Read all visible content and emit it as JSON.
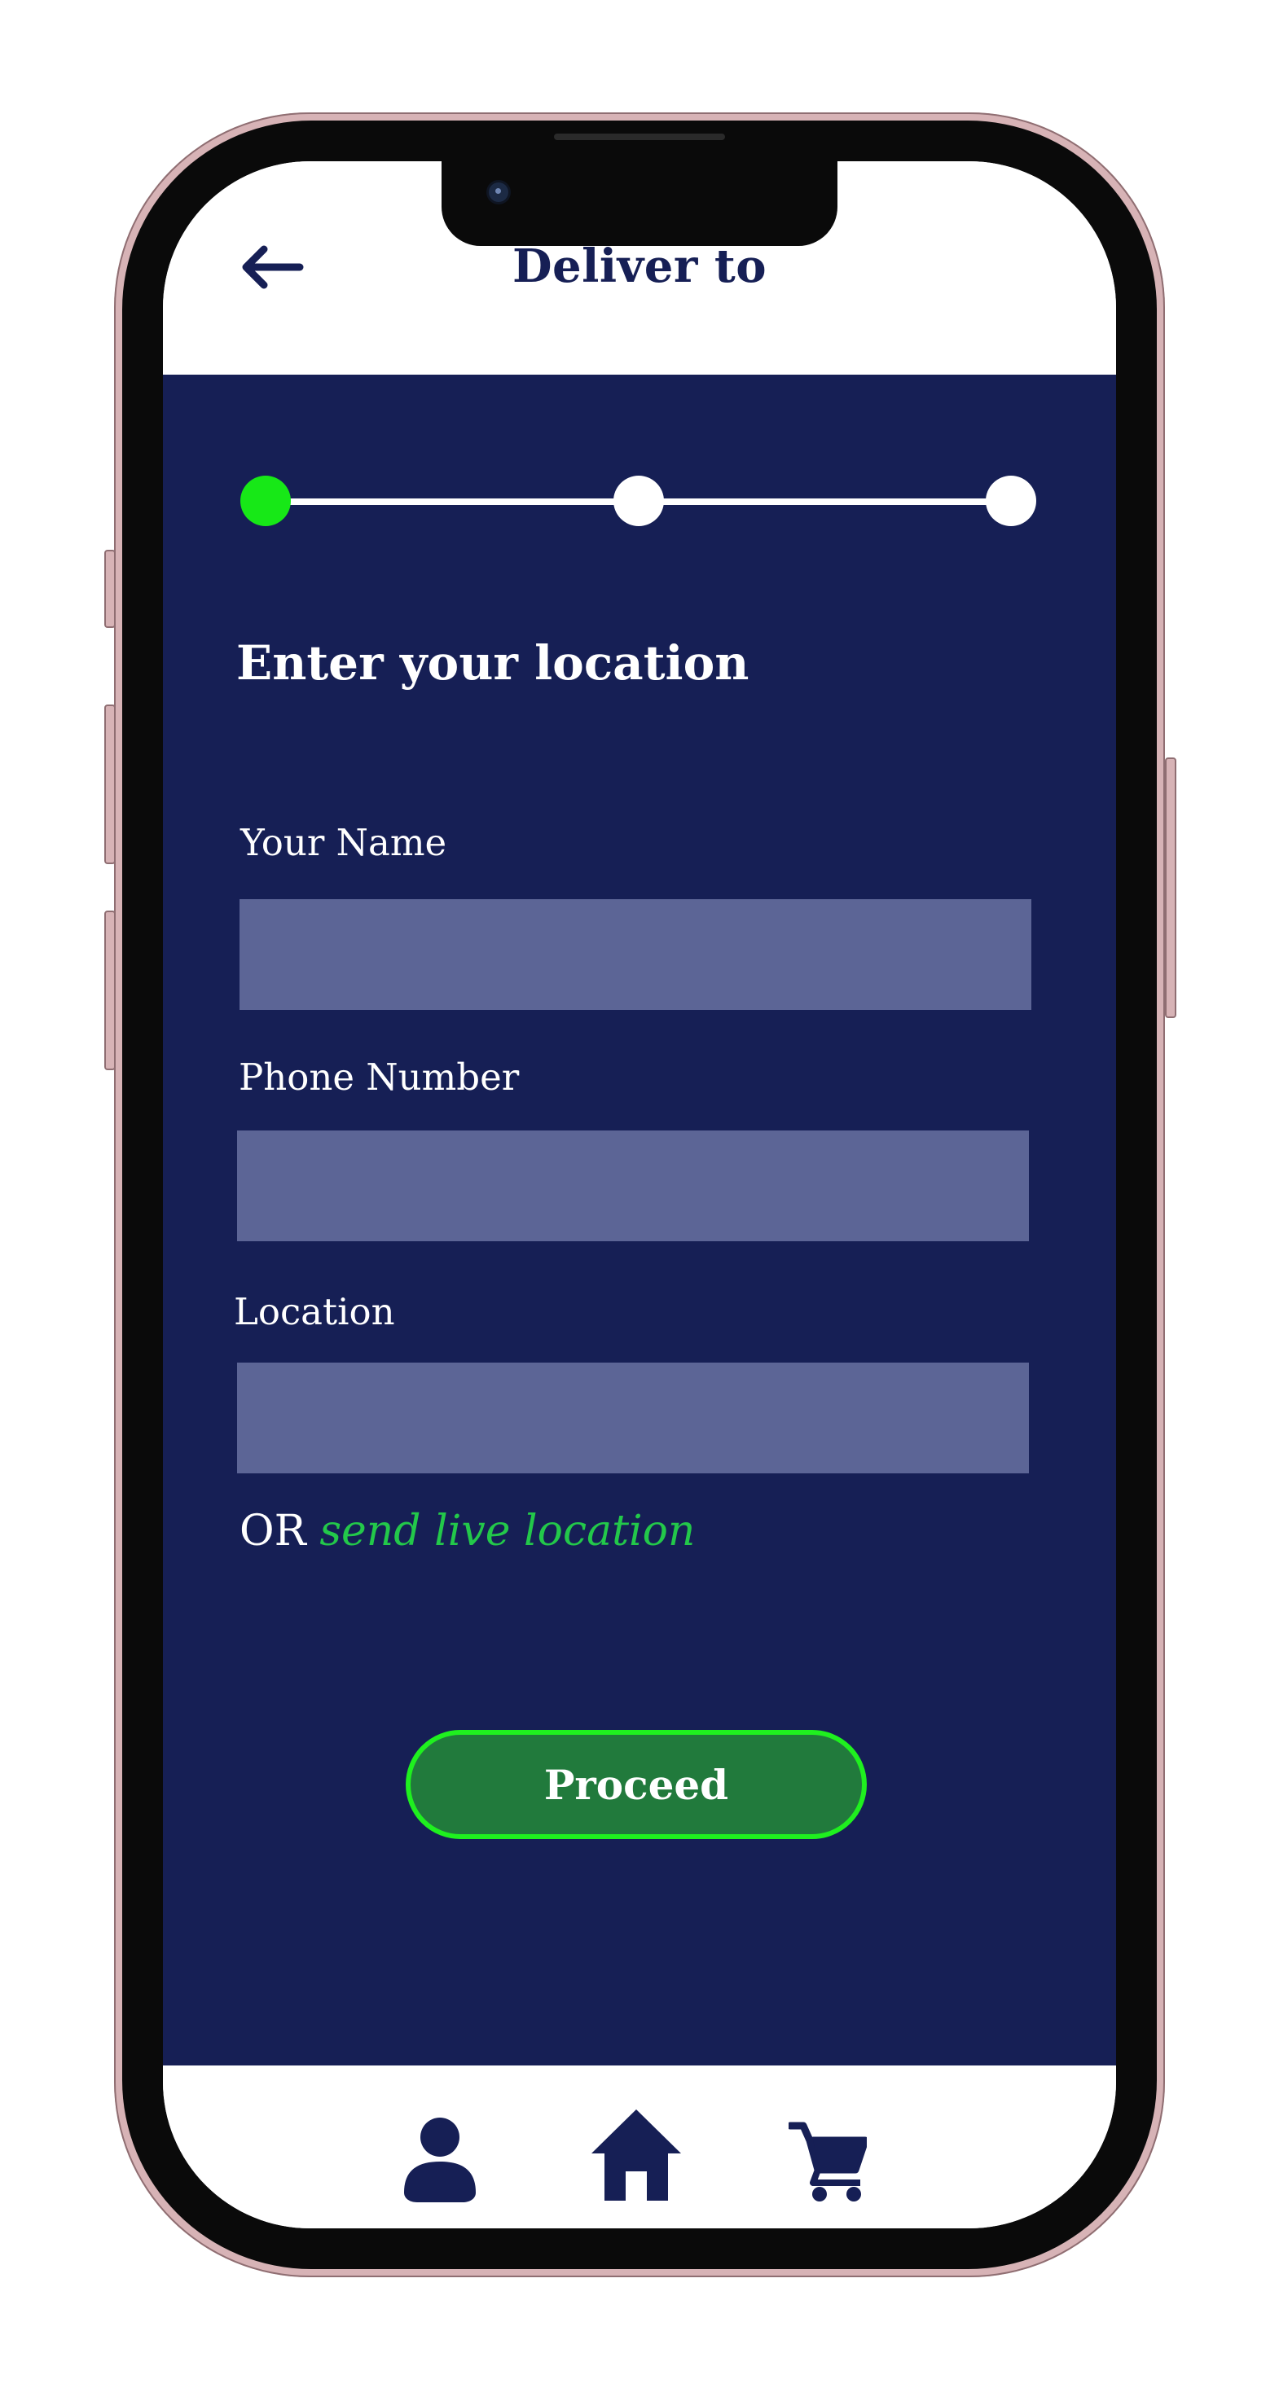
{
  "header": {
    "title": "Deliver to",
    "back_icon": "arrow-left-icon"
  },
  "stepper": {
    "steps": 3,
    "current_step": 1,
    "active_color": "#17e817",
    "inactive_color": "#ffffff"
  },
  "form": {
    "heading": "Enter your location",
    "fields": [
      {
        "label": "Your Name",
        "value": ""
      },
      {
        "label": "Phone Number",
        "value": ""
      },
      {
        "label": "Location",
        "value": ""
      }
    ],
    "or_text": "OR",
    "live_location_link": "send live location",
    "proceed_label": "Proceed"
  },
  "bottom_nav": {
    "items": [
      {
        "icon": "profile-icon"
      },
      {
        "icon": "home-icon"
      },
      {
        "icon": "cart-icon"
      }
    ]
  },
  "colors": {
    "brand_navy": "#161f55",
    "input_fill": "#5c6596",
    "accent_green": "#23c84a",
    "button_fill": "#217a3c",
    "button_border": "#1ff01f"
  }
}
